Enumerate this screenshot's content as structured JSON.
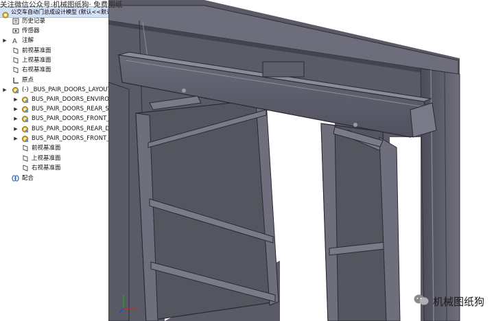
{
  "watermark": "关注微信公众号:机械图纸狗· 免费图纸",
  "brand": {
    "name": "机械图纸狗"
  },
  "tree": {
    "root_label": "公交车自动门总成设计模型  (默认<<默认",
    "items": [
      {
        "label": "历史记录",
        "icon": "history-icon"
      },
      {
        "label": "传感器",
        "icon": "sensor-icon"
      },
      {
        "label": "注解",
        "icon": "annotation-icon"
      },
      {
        "label": "前视基准面",
        "icon": "plane-icon"
      },
      {
        "label": "上视基准面",
        "icon": "plane-icon"
      },
      {
        "label": "右视基准面",
        "icon": "plane-icon"
      },
      {
        "label": "原点",
        "icon": "origin-icon"
      },
      {
        "label": "(-) _BUS_PAIR_DOORS_LAYOUT_1<",
        "icon": "part-icon"
      },
      {
        "label": "BUS_PAIR_DOORS_ENVIRONI",
        "icon": "part-icon"
      },
      {
        "label": "BUS_PAIR_DOORS_REAR_SHA",
        "icon": "part-icon"
      },
      {
        "label": "BUS_PAIR_DOORS_FRONT_SH",
        "icon": "part-icon"
      },
      {
        "label": "BUS_PAIR_DOORS_REAR_DOO",
        "icon": "part-icon"
      },
      {
        "label": "BUS_PAIR_DOORS_FRONT_DO",
        "icon": "part-icon"
      },
      {
        "label": "前视基准面",
        "icon": "plane-icon"
      },
      {
        "label": "上视基准面",
        "icon": "plane-icon"
      },
      {
        "label": "右视基准面",
        "icon": "plane-icon"
      },
      {
        "label": "配合",
        "icon": "mates-icon"
      }
    ]
  },
  "colors": {
    "selection": "#d3e2f6",
    "steel": "#5d5d6b",
    "steel_light": "#9a9aa8",
    "steel_dark": "#3b3b47"
  }
}
